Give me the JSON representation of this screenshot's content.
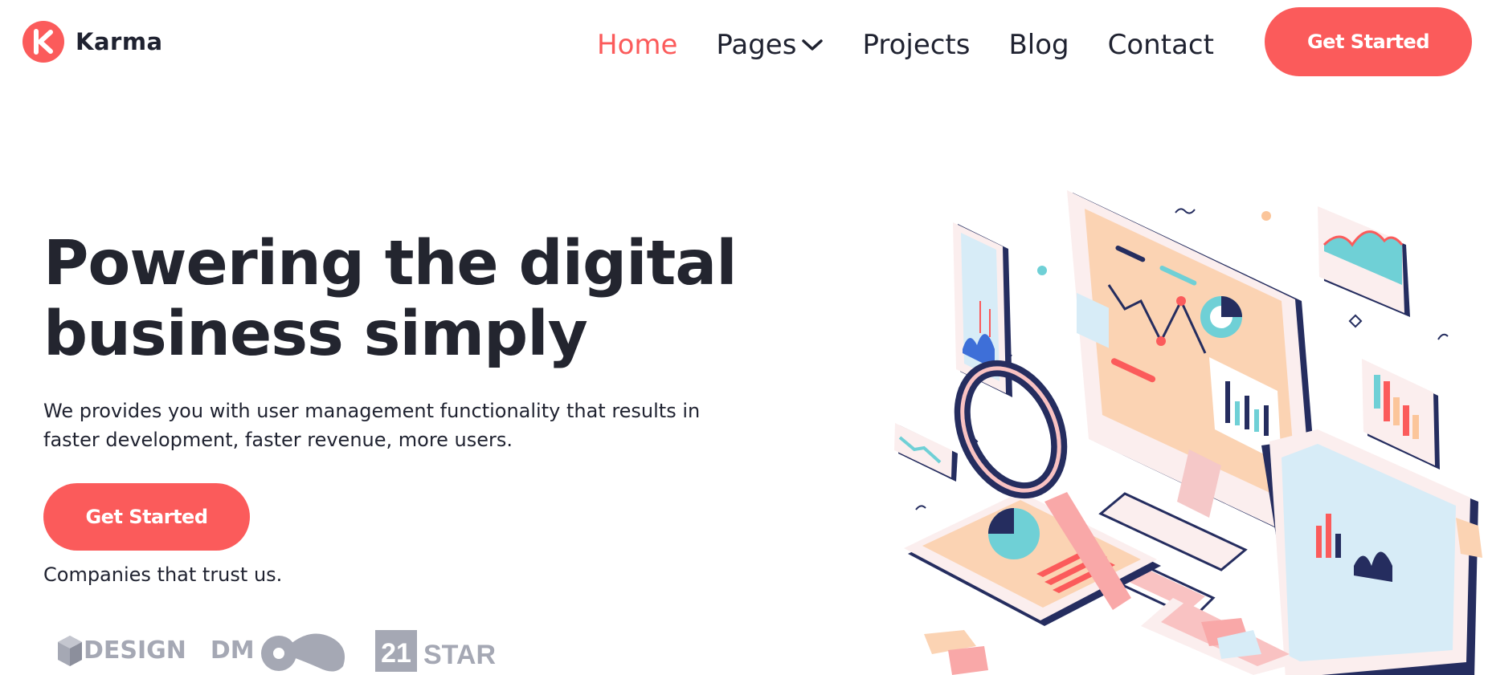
{
  "brand": {
    "name": "Karma",
    "logo_icon": "k-logo-icon",
    "accent": "#fb5b5b"
  },
  "nav": {
    "items": [
      {
        "label": "Home",
        "active": true
      },
      {
        "label": "Pages",
        "active": false,
        "has_dropdown": true
      },
      {
        "label": "Projects",
        "active": false
      },
      {
        "label": "Blog",
        "active": false
      },
      {
        "label": "Contact",
        "active": false
      }
    ],
    "cta_label": "Get Started"
  },
  "hero": {
    "title_line1": "Powering the digital",
    "title_line2": "business simply",
    "description": "We provides you with user management functionality that results in faster development, faster revenue, more users.",
    "cta_label": "Get Started",
    "trust_text": "Companies that trust us."
  },
  "brands": [
    {
      "name": "DESIGN",
      "icon": "cube-icon"
    },
    {
      "name": "DM",
      "icon": "blob-icon"
    },
    {
      "name": "21 STAR",
      "icon": "badge-icon"
    }
  ],
  "colors": {
    "primary": "#fb5b5b",
    "text": "#1f2230",
    "muted": "#a5a8b4",
    "navy": "#252d5f",
    "peach": "#fbd3b3",
    "teal": "#6fd0d6"
  }
}
